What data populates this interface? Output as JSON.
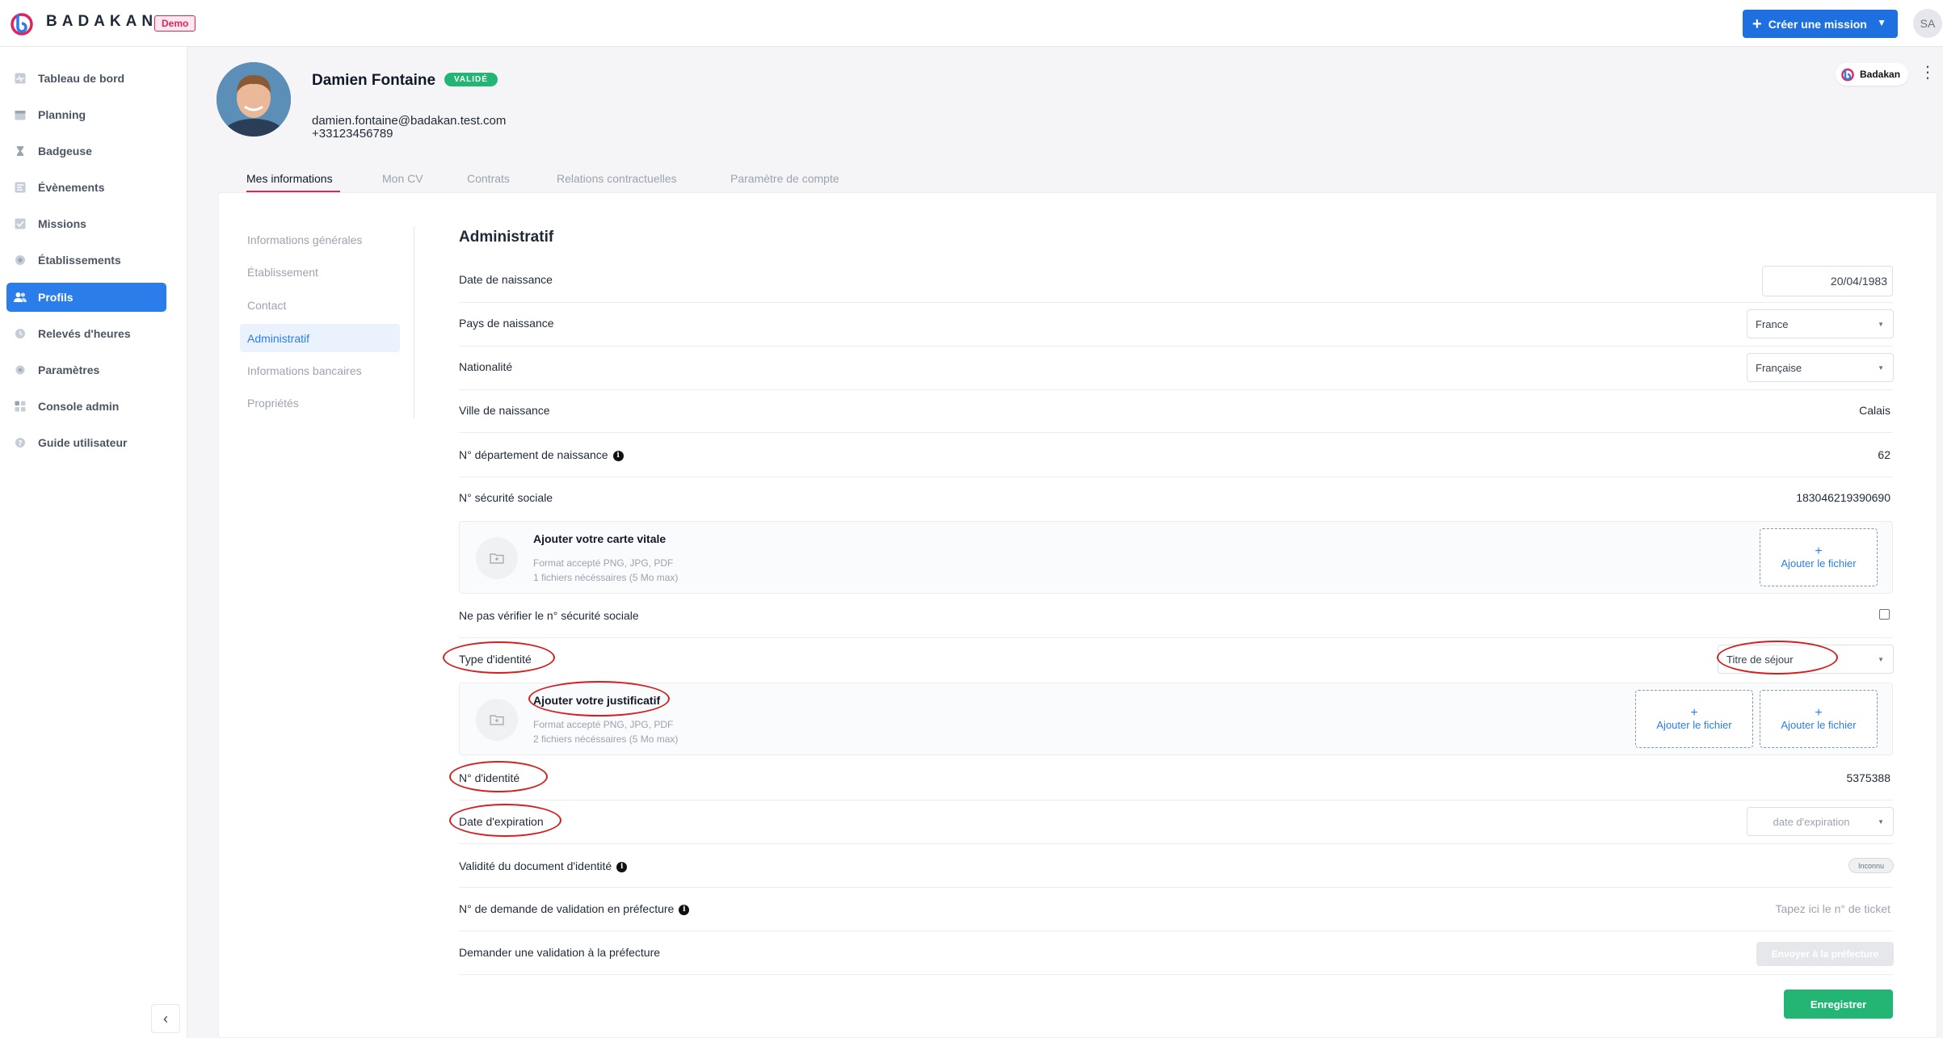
{
  "brand": {
    "name": "BADAKAN",
    "env_badge": "Demo",
    "accent": "#e0245e",
    "primary": "#2b7de9",
    "success": "#22b573"
  },
  "header": {
    "create_button": "Créer une mission",
    "user_initials": "SA"
  },
  "sidebar": {
    "items": [
      {
        "label": "Tableau de bord",
        "icon": "pulse-icon"
      },
      {
        "label": "Planning",
        "icon": "calendar-icon"
      },
      {
        "label": "Badgeuse",
        "icon": "hourglass-icon"
      },
      {
        "label": "Évènements",
        "icon": "list-icon"
      },
      {
        "label": "Missions",
        "icon": "checklist-icon"
      },
      {
        "label": "Établissements",
        "icon": "building-icon"
      },
      {
        "label": "Profils",
        "icon": "users-icon",
        "active": true
      },
      {
        "label": "Relevés d'heures",
        "icon": "clock-icon"
      },
      {
        "label": "Paramètres",
        "icon": "gear-icon"
      },
      {
        "label": "Console admin",
        "icon": "grid-icon"
      },
      {
        "label": "Guide utilisateur",
        "icon": "help-icon"
      }
    ],
    "collapse": "‹"
  },
  "profile": {
    "name": "Damien Fontaine",
    "status": "VALIDÉ",
    "email": "damien.fontaine@badakan.test.com",
    "phone": "+33123456789",
    "organization": "Badakan",
    "menu": "⋮"
  },
  "tabs": [
    "Mes informations",
    "Mon CV",
    "Contrats",
    "Relations contractuelles",
    "Paramètre de compte"
  ],
  "subnav": [
    "Informations générales",
    "Établissement",
    "Contact",
    "Administratif",
    "Informations bancaires",
    "Propriétés"
  ],
  "admin": {
    "title": "Administratif",
    "birth_date_label": "Date de naissance",
    "birth_date": "20/04/1983",
    "birth_country_label": "Pays de naissance",
    "birth_country": "France",
    "nationality_label": "Nationalité",
    "nationality": "Française",
    "birth_city_label": "Ville de naissance",
    "birth_city": "Calais",
    "birth_dept_label": "N° département de naissance",
    "birth_dept": "62",
    "ssn_label": "N° sécurité sociale",
    "ssn": "183046219390690",
    "vitale_upload": {
      "title": "Ajouter votre carte vitale",
      "formats": "Format accepté PNG, JPG, PDF",
      "required": "1 fichiers nécéssaires (5 Mo max)",
      "add": "Ajouter le fichier"
    },
    "skip_ssn_label": "Ne pas vérifier le n° sécurité sociale",
    "id_type_label": "Type d'identité",
    "id_type": "Titre de séjour",
    "id_upload": {
      "title": "Ajouter votre justificatif",
      "formats": "Format accepté PNG, JPG, PDF",
      "required": "2 fichiers nécéssaires (5 Mo max)",
      "add1": "Ajouter le fichier",
      "add2": "Ajouter le fichier"
    },
    "id_number_label": "N° d'identité",
    "id_number": "5375388",
    "expiry_label": "Date d'expiration",
    "expiry_placeholder": "date d'expiration",
    "validity_label": "Validité du document d'identité",
    "validity": "Inconnu",
    "prefecture_request_label": "N° de demande de validation en préfecture",
    "ticket_placeholder": "Tapez ici le n° de ticket",
    "prefecture_validation_label": "Demander une validation à la préfecture",
    "prefecture_button": "Envoyer à la préfecture",
    "save": "Enregistrer"
  }
}
